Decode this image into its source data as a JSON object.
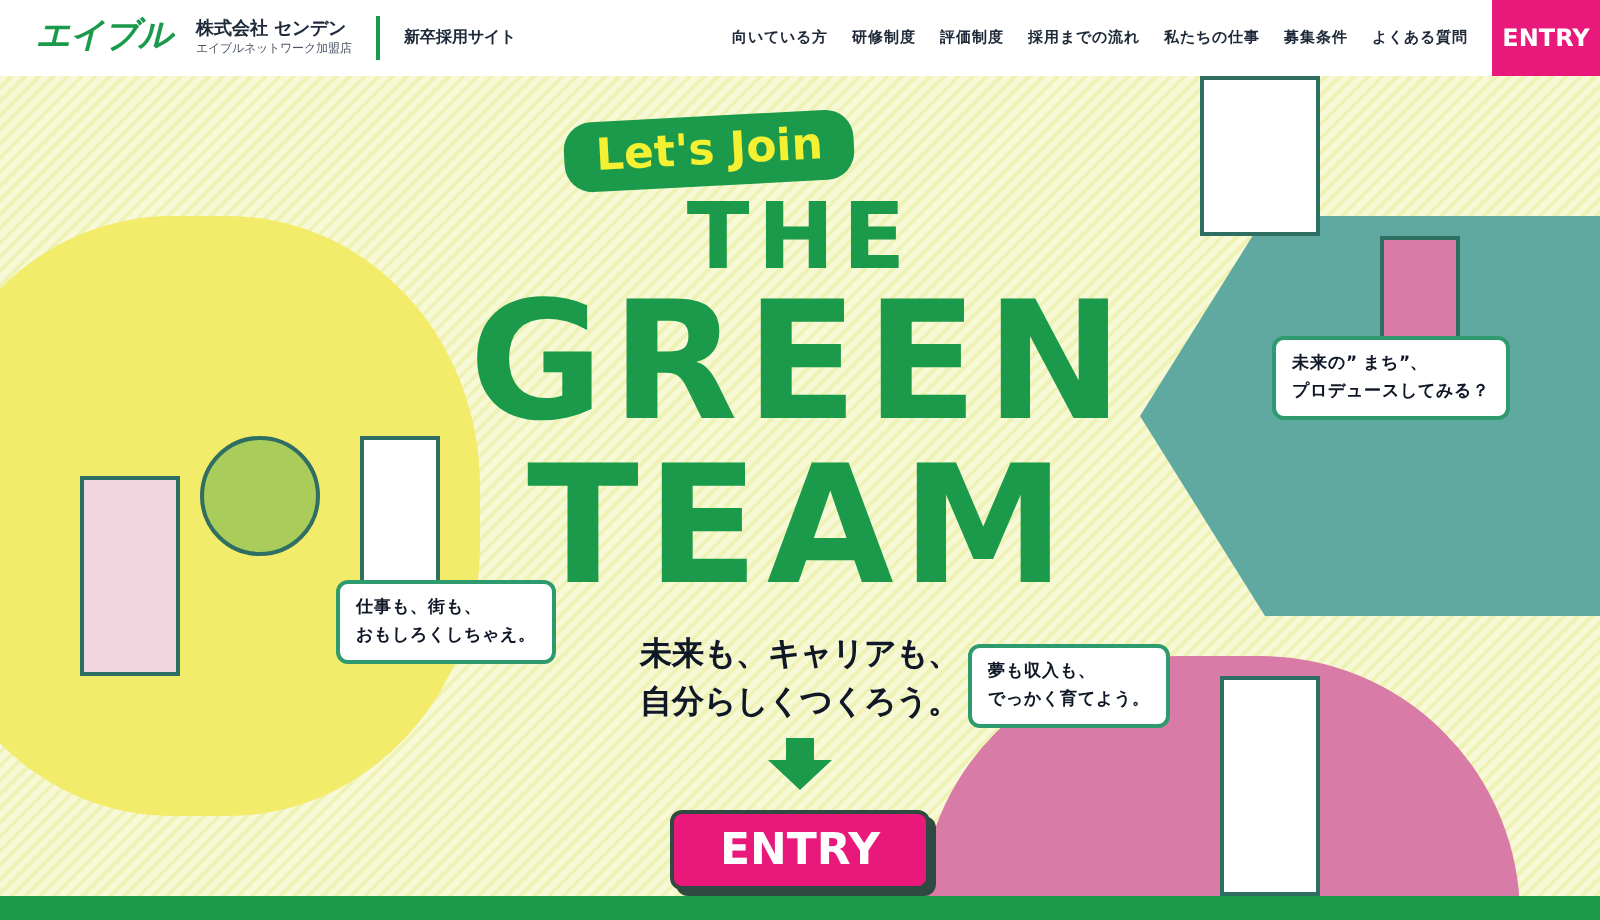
{
  "header": {
    "logo": "エイブル",
    "company": "株式会社 センデン",
    "company_sub": "エイブルネットワーク加盟店",
    "site_label": "新卒採用サイト",
    "nav": [
      "向いている方",
      "研修制度",
      "評価制度",
      "採用までの流れ",
      "私たちの仕事",
      "募集条件",
      "よくある質問"
    ],
    "entry": "ENTRY"
  },
  "hero": {
    "badge": "Let's Join",
    "title_lines": [
      "THE",
      "GREEN",
      "TEAM"
    ],
    "tagline": [
      "未来も、キャリアも、",
      "自分らしくつくろう。"
    ],
    "entry": "ENTRY",
    "bubbles": [
      {
        "lines": [
          "仕事も、街も、",
          "おもしろくしちゃえ。"
        ]
      },
      {
        "lines": [
          "未来の” まち”、",
          "プロデュースしてみる？"
        ]
      },
      {
        "lines": [
          "夢も収入も、",
          "でっかく育てよう。"
        ]
      }
    ]
  }
}
